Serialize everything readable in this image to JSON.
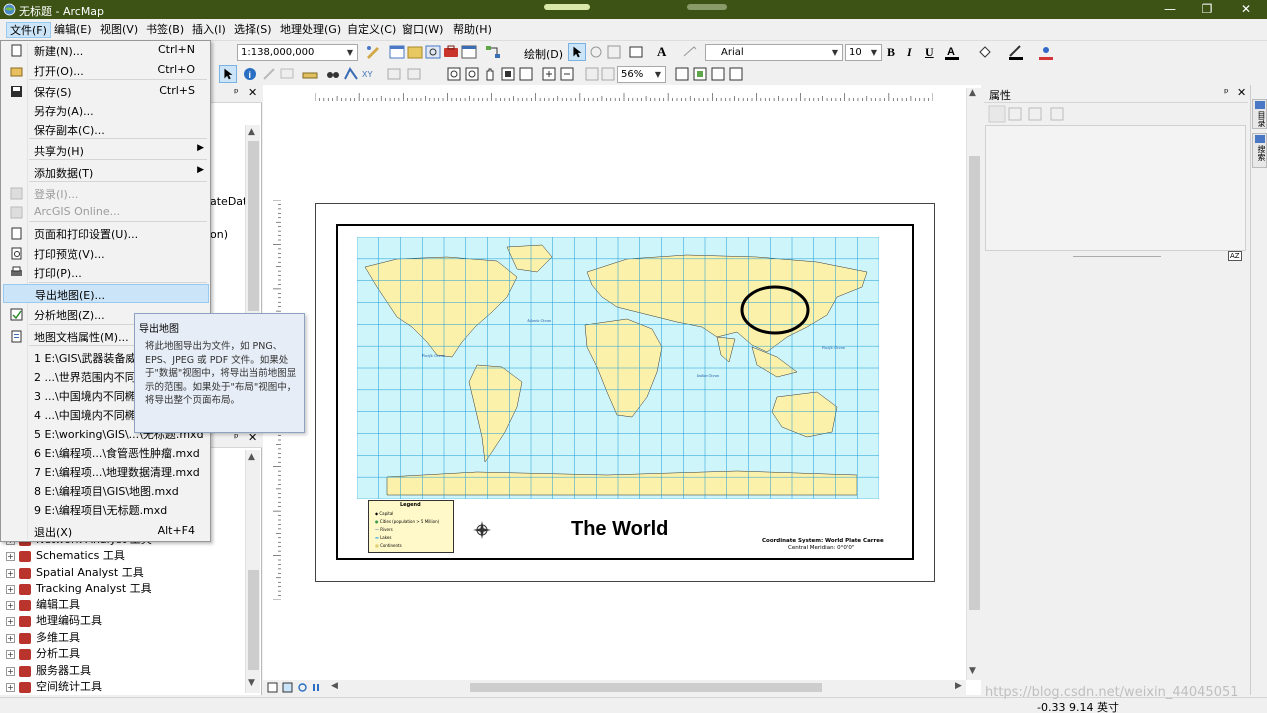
{
  "window": {
    "title": "无标题 - ArcMap",
    "controls": [
      "—",
      "❐",
      "✕"
    ]
  },
  "menubar": [
    "文件(F)",
    "编辑(E)",
    "视图(V)",
    "书签(B)",
    "插入(I)",
    "选择(S)",
    "地理处理(G)",
    "自定义(C)",
    "窗口(W)",
    "帮助(H)"
  ],
  "toolbar": {
    "scale": "1:138,000,000",
    "draw_label": "绘制(D)",
    "font_name": "Arial",
    "font_size": "10",
    "bold": "B",
    "italic": "I",
    "underline": "U",
    "zoom": "56%",
    "text_tool": "A"
  },
  "file_menu": {
    "items": [
      {
        "label": "新建(N)...",
        "shortcut": "Ctrl+N",
        "icon": "new-document-icon"
      },
      {
        "label": "打开(O)...",
        "shortcut": "Ctrl+O",
        "icon": "open-folder-icon"
      },
      {
        "label": "保存(S)",
        "shortcut": "Ctrl+S",
        "icon": "save-icon"
      },
      {
        "label": "另存为(A)...",
        "shortcut": "",
        "icon": ""
      },
      {
        "label": "保存副本(C)...",
        "shortcut": "",
        "icon": ""
      },
      {
        "label": "共享为(H)",
        "shortcut": "",
        "icon": "",
        "submenu": true
      },
      {
        "label": "添加数据(T)",
        "shortcut": "",
        "icon": "",
        "submenu": true
      },
      {
        "label": "登录(I)...",
        "shortcut": "",
        "icon": "sign-in-icon",
        "disabled": true
      },
      {
        "label": "ArcGIS Online...",
        "shortcut": "",
        "icon": "arcgis-online-icon",
        "disabled": true
      },
      {
        "label": "页面和打印设置(U)...",
        "shortcut": "",
        "icon": "page-setup-icon"
      },
      {
        "label": "打印预览(V)...",
        "shortcut": "",
        "icon": "print-preview-icon"
      },
      {
        "label": "打印(P)...",
        "shortcut": "",
        "icon": "print-icon"
      },
      {
        "label": "导出地图(E)...",
        "shortcut": "",
        "icon": "",
        "highlighted": true
      },
      {
        "label": "分析地图(Z)...",
        "shortcut": "",
        "icon": "analyze-map-icon"
      },
      {
        "label": "地图文档属性(M)...",
        "shortcut": "",
        "icon": "document-properties-icon"
      },
      {
        "label": "1 E:\\GIS\\武器装备威力",
        "shortcut": "",
        "icon": ""
      },
      {
        "label": "2 ...\\世界范围内不同椭",
        "shortcut": "",
        "icon": ""
      },
      {
        "label": "3 ...\\中国境内不同椭球",
        "shortcut": "",
        "icon": ""
      },
      {
        "label": "4 ...\\中国境内不同椭球",
        "shortcut": "",
        "icon": ""
      },
      {
        "label": "5 E:\\working\\GIS\\...\\无标题.mxd",
        "shortcut": "",
        "icon": ""
      },
      {
        "label": "6 E:\\编程项...\\食管恶性肿瘤.mxd",
        "shortcut": "",
        "icon": ""
      },
      {
        "label": "7 E:\\编程项...\\地理数据清理.mxd",
        "shortcut": "",
        "icon": ""
      },
      {
        "label": "8 E:\\编程项目\\GIS\\地图.mxd",
        "shortcut": "",
        "icon": ""
      },
      {
        "label": "9 E:\\编程项目\\无标题.mxd",
        "shortcut": "",
        "icon": ""
      },
      {
        "label": "退出(X)",
        "shortcut": "Alt+F4",
        "icon": ""
      }
    ]
  },
  "tooltip": {
    "title": "导出地图",
    "body": "将此地图导出为文件，如 PNG、EPS、JPEG 或 PDF 文件。如果处于\"数据\"视图中，将导出当前地图显示的范围。如果处于\"布局\"视图中，将导出整个页面布局。"
  },
  "left_panel": {
    "partial_texts": [
      "ateData",
      "on)"
    ],
    "pin": "ᵖ",
    "close": "✕",
    "tools": [
      "Network Analyst 工具",
      "Schematics 工具",
      "Spatial Analyst 工具",
      "Tracking Analyst 工具",
      "编辑工具",
      "地理编码工具",
      "多维工具",
      "分析工具",
      "服务器工具",
      "空间统计工具"
    ]
  },
  "map": {
    "title": "The World",
    "ocean_labels": [
      "Atlantic Ocean",
      "Pacific Ocean",
      "Indian Ocean",
      "Pacific Ocean"
    ],
    "legend": {
      "title": "Legend",
      "items": [
        "Capital",
        "Cities (population > 5 Million)",
        "Rivers",
        "Lakes",
        "Continents"
      ]
    },
    "coord_system": "Coordinate System: World Plate Carree",
    "central_meridian": "Central Meridian: 0°0'0\""
  },
  "right_panel": {
    "title": "属性",
    "pin": "ᵖ",
    "close": "✕",
    "az": "AZ"
  },
  "side_tabs": [
    "目录",
    "搜索"
  ],
  "status": {
    "coords": "-0.33  9.14 英寸",
    "watermark": "https://blog.csdn.net/weixin_44045051"
  },
  "colors": {
    "titlebar": "#3d5316",
    "ocean": "#cdf5fa",
    "land": "#fbf1aa",
    "grid": "#1e9cd7",
    "menu_highlight": "#cce4f7"
  }
}
